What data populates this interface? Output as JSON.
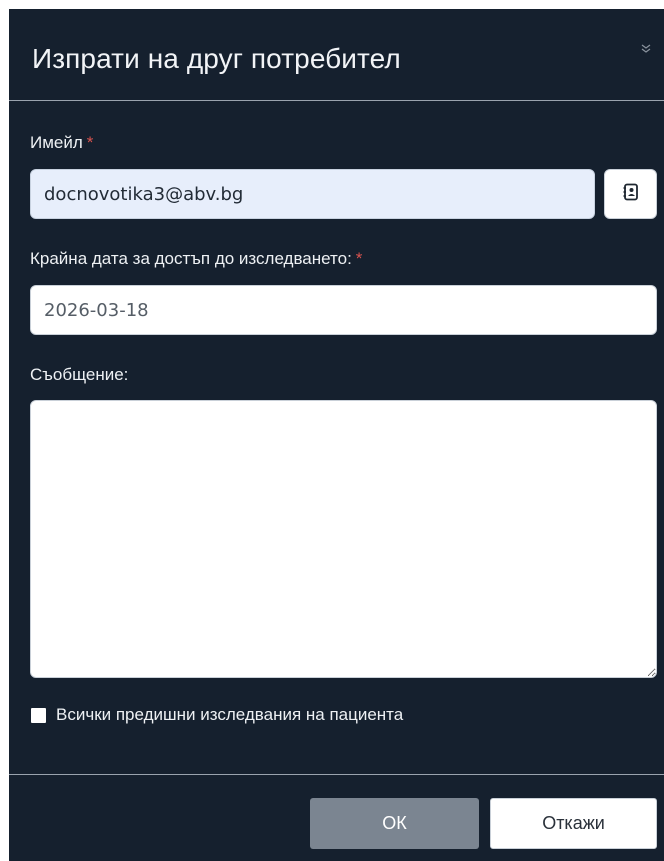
{
  "dialog": {
    "title": "Изпрати на друг потребител",
    "collapse_icon": "double-chevron-down-icon"
  },
  "email": {
    "label": "Имейл",
    "required_marker": "*",
    "value": "docnovotika3@abv.bg",
    "contacts_icon": "address-book-icon"
  },
  "access_date": {
    "label": "Крайна дата за достъп до изследването:",
    "required_marker": "*",
    "value": "2026-03-18"
  },
  "message": {
    "label": "Съобщение:",
    "value": ""
  },
  "all_studies": {
    "label": "Всички предишни изследвания на пациента",
    "checked": false
  },
  "footer": {
    "ok_label": "ОК",
    "cancel_label": "Откажи"
  },
  "colors": {
    "dialog_bg": "#15202e",
    "required": "#d9534f",
    "ok_button": "#7b8591",
    "email_field_bg": "#e7eefb"
  }
}
